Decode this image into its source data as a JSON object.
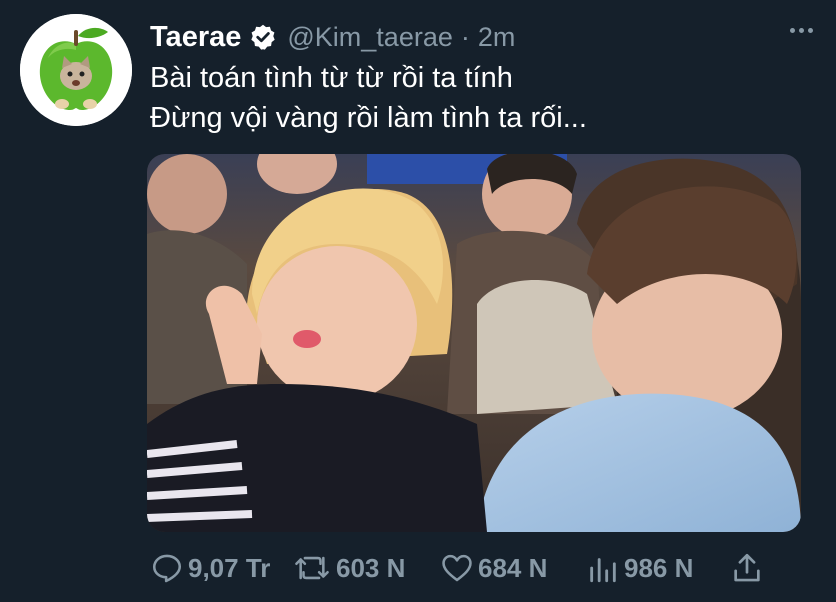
{
  "tweet": {
    "author": {
      "display_name": "Taerae",
      "handle": "@Kim_taerae",
      "verified": true,
      "avatar_icon": "green-apple-cat-avatar"
    },
    "separator": "·",
    "timestamp": "2m",
    "text_lines": [
      "Bài toán tình từ từ rồi ta tính",
      "Đừng vội vàng rồi làm tình ta rối..."
    ],
    "media": {
      "type": "photo"
    },
    "actions": {
      "reply": {
        "icon": "reply-icon",
        "count": "9,07 Tr"
      },
      "retweet": {
        "icon": "retweet-icon",
        "count": "603 N"
      },
      "like": {
        "icon": "heart-icon",
        "count": "684 N"
      },
      "views": {
        "icon": "analytics-icon",
        "count": "986 N"
      },
      "share": {
        "icon": "share-icon"
      }
    }
  },
  "colors": {
    "background": "#15202b",
    "primary_text": "#ffffff",
    "secondary_text": "#8899a6"
  }
}
